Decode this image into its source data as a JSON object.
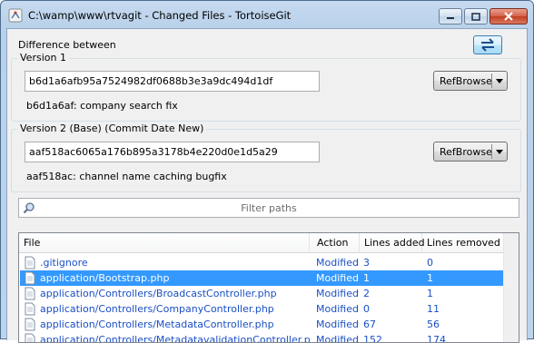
{
  "window": {
    "title": "C:\\wamp\\www\\rtvagit - Changed Files - TortoiseGit"
  },
  "header": {
    "difference_label": "Difference between"
  },
  "version1": {
    "group_title": "Version 1",
    "hash": "b6d1a6afb95a7524982df0688b3e3a9dc494d1df",
    "message": "b6d1a6af: company search fix",
    "refbrowse_label": "RefBrowse"
  },
  "version2": {
    "group_title": "Version 2 (Base) (Commit Date New)",
    "hash": "aaf518ac6065a176b895a3178b4e220d0e1d5a29",
    "message": "aaf518ac: channel name caching bugfix",
    "refbrowse_label": "RefBrowse"
  },
  "filter": {
    "placeholder": "Filter paths"
  },
  "file_list": {
    "columns": [
      "File",
      "Action",
      "Lines added",
      "Lines removed"
    ],
    "rows": [
      {
        "file": ".gitignore",
        "action": "Modified",
        "added": "3",
        "removed": "0"
      },
      {
        "file": "application/Bootstrap.php",
        "action": "Modified",
        "added": "1",
        "removed": "1",
        "selected": true
      },
      {
        "file": "application/Controllers/BroadcastController.php",
        "action": "Modified",
        "added": "2",
        "removed": "1"
      },
      {
        "file": "application/Controllers/CompanyController.php",
        "action": "Modified",
        "added": "0",
        "removed": "11"
      },
      {
        "file": "application/Controllers/MetadataController.php",
        "action": "Modified",
        "added": "67",
        "removed": "56"
      },
      {
        "file": "application/Controllers/MetadatavalidationController.php",
        "action": "Modified",
        "added": "152",
        "removed": "174"
      }
    ]
  },
  "colors": {
    "selection": "#3399ff",
    "link_text": "#1a4fc6",
    "titlebar": "#b9d1ea"
  }
}
